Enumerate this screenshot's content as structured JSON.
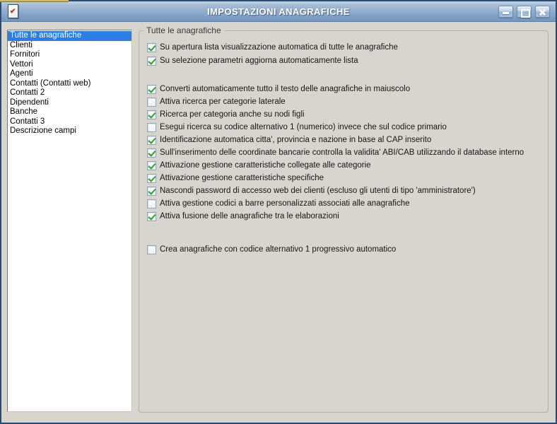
{
  "window": {
    "title": "IMPOSTAZIONI ANAGRAFICHE",
    "controls": [
      {
        "name": "minimize"
      },
      {
        "name": "maximize"
      },
      {
        "name": "close"
      }
    ]
  },
  "sidebar": {
    "items": [
      {
        "label": "Tutte le anagrafiche",
        "selected": true
      },
      {
        "label": "Clienti",
        "selected": false
      },
      {
        "label": "Fornitori",
        "selected": false
      },
      {
        "label": "Vettori",
        "selected": false
      },
      {
        "label": "Agenti",
        "selected": false
      },
      {
        "label": "Contatti (Contatti web)",
        "selected": false
      },
      {
        "label": "Contatti 2",
        "selected": false
      },
      {
        "label": "Dipendenti",
        "selected": false
      },
      {
        "label": "Banche",
        "selected": false
      },
      {
        "label": "Contatti 3",
        "selected": false
      },
      {
        "label": "Descrizione campi",
        "selected": false
      }
    ]
  },
  "panel": {
    "group_title": "Tutte le anagrafiche",
    "checkbox_groups": [
      {
        "items": [
          {
            "label": "Su apertura lista visualizzazione automatica di tutte le anagrafiche",
            "checked": true
          },
          {
            "label": "Su selezione parametri aggiorna automaticamente lista",
            "checked": true
          }
        ]
      },
      {
        "items": [
          {
            "label": "Converti automaticamente tutto il testo delle anagrafiche in maiuscolo",
            "checked": true
          },
          {
            "label": "Attiva ricerca per categorie laterale",
            "checked": false
          },
          {
            "label": "Ricerca per categoria anche su nodi figli",
            "checked": true
          },
          {
            "label": "Esegui ricerca su codice alternativo 1 (numerico) invece che sul codice primario",
            "checked": false
          },
          {
            "label": "Identificazione automatica citta', provincia e nazione in base al CAP inserito",
            "checked": true
          },
          {
            "label": "Sull'inserimento delle coordinate bancarie controlla la validita' ABI/CAB utilizzando il database interno",
            "checked": true
          },
          {
            "label": "Attivazione gestione caratteristiche collegate alle categorie",
            "checked": true
          },
          {
            "label": "Attivazione gestione caratteristiche specifiche",
            "checked": true
          },
          {
            "label": "Nascondi password di accesso web dei clienti (escluso gli utenti di tipo 'amministratore')",
            "checked": true
          },
          {
            "label": "Attiva gestione codici a barre personalizzati associati alle anagrafiche",
            "checked": false
          },
          {
            "label": "Attiva fusione delle anagrafiche tra le elaborazioni",
            "checked": true
          }
        ]
      },
      {
        "items": [
          {
            "label": "Crea anagrafiche con codice alternativo 1 progressivo automatico",
            "checked": false
          }
        ]
      }
    ]
  },
  "colors": {
    "background": "#d8d5cf",
    "window_border": "#2b4a6e",
    "titlebar_top": "#a7bdd7",
    "titlebar_bottom": "#7495bd",
    "selection": "#2d7de2",
    "check_green": "#2f9e33",
    "groupbox_border": "#b2b2aa"
  }
}
